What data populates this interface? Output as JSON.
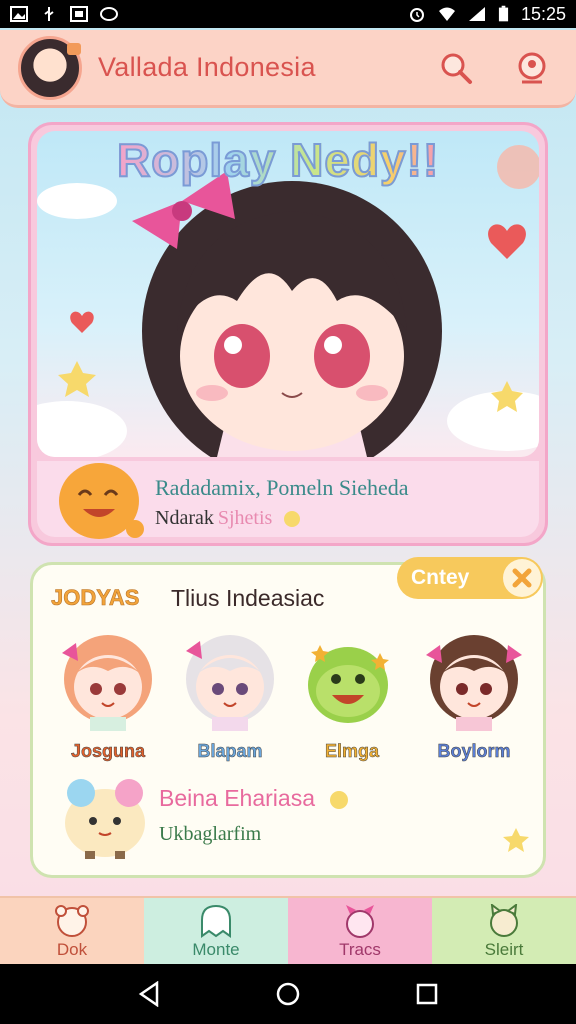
{
  "status_bar": {
    "time": "15:25"
  },
  "header": {
    "title": "Vallada Indonesia",
    "icons": [
      "search-icon",
      "profile-icon"
    ]
  },
  "hero": {
    "title": "Roplay Nedy!!",
    "line1": "Radadamix, Pomeln Sieheda",
    "line2_main": "Ndarak",
    "line2_accent": "Sjhetis"
  },
  "characters": {
    "badge": "JODYAS",
    "title": "Tlius Indeasiac",
    "cta_label": "Cntey",
    "items": [
      {
        "name": "Josguna",
        "color": "#e2612b"
      },
      {
        "name": "Blapam",
        "color": "#6aa6dc"
      },
      {
        "name": "Elmga",
        "color": "#f2b134"
      },
      {
        "name": "Boylorm",
        "color": "#5b7fd6"
      }
    ],
    "featured": {
      "name": "Beina Ehariasa",
      "sub": "Ukbaglarfim"
    }
  },
  "tabs": [
    {
      "label": "Dok",
      "color": "#fbd4be",
      "text_color": "#c0503a"
    },
    {
      "label": "Monte",
      "color": "#cdeee0",
      "text_color": "#3a8a6a"
    },
    {
      "label": "Tracs",
      "color": "#f7b6d0",
      "text_color": "#a0386a"
    },
    {
      "label": "Sleirt",
      "color": "#d3ecb4",
      "text_color": "#4a7a3a"
    }
  ],
  "colors": {
    "header_bg": "#fcd3c6",
    "title_red": "#d9534f",
    "card_pink": "#f8c9dd",
    "accent_yellow": "#f7c95c"
  }
}
